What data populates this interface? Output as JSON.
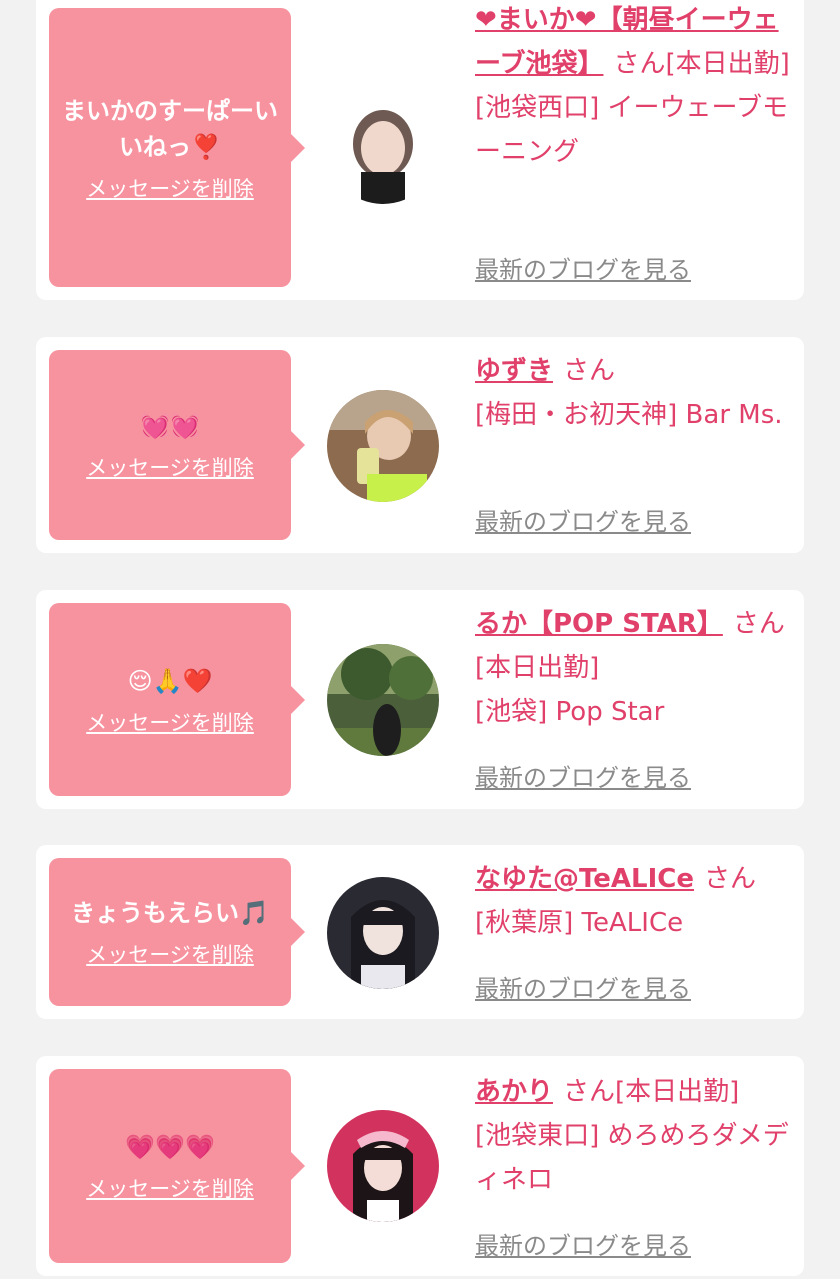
{
  "cards": [
    {
      "message": "まいかのすーぱーいいねっ❣️",
      "delete_label": "メッセージを削除",
      "name": "❤︎まいか❤︎【朝昼イーウェーブ池袋】",
      "san": "さん",
      "status": "[本日出勤]",
      "location": "[池袋西口] イーウェーブモーニング",
      "blog_label": "最新のブログを見る"
    },
    {
      "message": "💓💓",
      "delete_label": "メッセージを削除",
      "name": "ゆずき",
      "san": "さん",
      "status": "",
      "location": "[梅田・お初天神] Bar Ms.",
      "blog_label": "最新のブログを見る"
    },
    {
      "message": "😌🙏❤️",
      "delete_label": "メッセージを削除",
      "name": "るか【POP STAR】",
      "san": "さん",
      "status": "[本日出勤]",
      "location": "[池袋] Pop Star",
      "blog_label": "最新のブログを見る"
    },
    {
      "message": "きょうもえらい🎵",
      "delete_label": "メッセージを削除",
      "name": "なゆた@TeALICe",
      "san": "さん",
      "status": "",
      "location": "[秋葉原] TeALICe",
      "blog_label": "最新のブログを見る"
    },
    {
      "message": "💗💗💗",
      "delete_label": "メッセージを削除",
      "name": "あかり",
      "san": "さん",
      "status": "[本日出勤]",
      "location": "[池袋東口] めろめろダメディネロ",
      "blog_label": "最新のブログを見る"
    }
  ]
}
